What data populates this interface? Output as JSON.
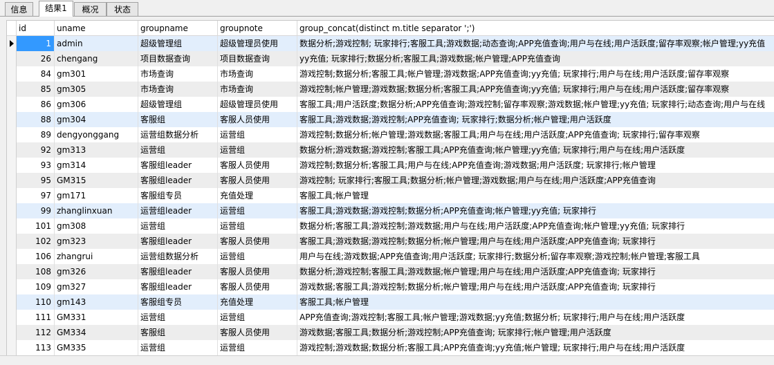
{
  "tabs": [
    {
      "label": "信息"
    },
    {
      "label": "结果1"
    },
    {
      "label": "概况"
    },
    {
      "label": "状态"
    }
  ],
  "columns": [
    "id",
    "uname",
    "groupname",
    "groupnote",
    "group_concat(distinct m.title separator ';')"
  ],
  "rows": [
    {
      "id": "1",
      "uname": "admin",
      "groupname": "超级管理组",
      "groupnote": "超级管理员使用",
      "titles": "数据分析;游戏控制; 玩家排行;客服工具;游戏数据;动态查询;APP充值查询;用户与在线;用户活跃度;留存率观察;帐户管理;yy充值"
    },
    {
      "id": "26",
      "uname": "chengang",
      "groupname": "项目数据查询",
      "groupnote": "项目数据查询",
      "titles": "yy充值; 玩家排行;数据分析;客服工具;游戏数据;帐户管理;APP充值查询"
    },
    {
      "id": "84",
      "uname": "gm301",
      "groupname": "市场查询",
      "groupnote": "市场查询",
      "titles": "游戏控制;数据分析;客服工具;帐户管理;游戏数据;APP充值查询;yy充值; 玩家排行;用户与在线;用户活跃度;留存率观察"
    },
    {
      "id": "85",
      "uname": "gm305",
      "groupname": "市场查询",
      "groupnote": "市场查询",
      "titles": "游戏控制;帐户管理;游戏数据;数据分析;客服工具;APP充值查询;yy充值; 玩家排行;用户与在线;用户活跃度;留存率观察"
    },
    {
      "id": "86",
      "uname": "gm306",
      "groupname": "超级管理组",
      "groupnote": "超级管理员使用",
      "titles": "客服工具;用户活跃度;数据分析;APP充值查询;游戏控制;留存率观察;游戏数据;帐户管理;yy充值; 玩家排行;动态查询;用户与在线"
    },
    {
      "id": "88",
      "uname": "gm304",
      "groupname": "客服组",
      "groupnote": "客服人员使用",
      "titles": "客服工具;游戏数据;游戏控制;APP充值查询; 玩家排行;数据分析;帐户管理;用户活跃度"
    },
    {
      "id": "89",
      "uname": "dengyonggang",
      "groupname": "运营组数据分析",
      "groupnote": "运营组",
      "titles": "游戏控制;数据分析;帐户管理;游戏数据;客服工具;用户与在线;用户活跃度;APP充值查询; 玩家排行;留存率观察"
    },
    {
      "id": "92",
      "uname": "gm313",
      "groupname": "运营组",
      "groupnote": "运营组",
      "titles": "数据分析;游戏数据;游戏控制;客服工具;APP充值查询;帐户管理;yy充值; 玩家排行;用户与在线;用户活跃度"
    },
    {
      "id": "93",
      "uname": "gm314",
      "groupname": "客服组leader",
      "groupnote": "客服人员使用",
      "titles": "游戏控制;数据分析;客服工具;用户与在线;APP充值查询;游戏数据;用户活跃度; 玩家排行;帐户管理"
    },
    {
      "id": "95",
      "uname": "GM315",
      "groupname": "客服组leader",
      "groupnote": "客服人员使用",
      "titles": "游戏控制; 玩家排行;客服工具;数据分析;帐户管理;游戏数据;用户与在线;用户活跃度;APP充值查询"
    },
    {
      "id": "97",
      "uname": "gm171",
      "groupname": "客服组专员",
      "groupnote": "充值处理",
      "titles": "客服工具;帐户管理"
    },
    {
      "id": "99",
      "uname": "zhanglinxuan",
      "groupname": "运营组leader",
      "groupnote": "运营组",
      "titles": "客服工具;游戏数据;游戏控制;数据分析;APP充值查询;帐户管理;yy充值; 玩家排行"
    },
    {
      "id": "101",
      "uname": "gm308",
      "groupname": "运营组",
      "groupnote": "运营组",
      "titles": "数据分析;客服工具;游戏控制;游戏数据;用户与在线;用户活跃度;APP充值查询;帐户管理;yy充值; 玩家排行"
    },
    {
      "id": "102",
      "uname": "gm323",
      "groupname": "客服组leader",
      "groupnote": "客服人员使用",
      "titles": "客服工具;游戏数据;游戏控制;数据分析;帐户管理;用户与在线;用户活跃度;APP充值查询; 玩家排行"
    },
    {
      "id": "106",
      "uname": "zhangrui",
      "groupname": "运营组数据分析",
      "groupnote": "运营组",
      "titles": "用户与在线;游戏数据;APP充值查询;用户活跃度; 玩家排行;数据分析;留存率观察;游戏控制;帐户管理;客服工具"
    },
    {
      "id": "108",
      "uname": "gm326",
      "groupname": "客服组leader",
      "groupnote": "客服人员使用",
      "titles": "数据分析;游戏控制;客服工具;游戏数据;帐户管理;用户与在线;用户活跃度;APP充值查询; 玩家排行"
    },
    {
      "id": "109",
      "uname": "gm327",
      "groupname": "客服组leader",
      "groupnote": "客服人员使用",
      "titles": "游戏数据;客服工具;游戏控制;数据分析;帐户管理;用户与在线;用户活跃度;APP充值查询; 玩家排行"
    },
    {
      "id": "110",
      "uname": "gm143",
      "groupname": "客服组专员",
      "groupnote": "充值处理",
      "titles": "客服工具;帐户管理"
    },
    {
      "id": "111",
      "uname": "GM331",
      "groupname": "运营组",
      "groupnote": "运营组",
      "titles": "APP充值查询;游戏控制;客服工具;帐户管理;游戏数据;yy充值;数据分析; 玩家排行;用户与在线;用户活跃度"
    },
    {
      "id": "112",
      "uname": "GM334",
      "groupname": "客服组",
      "groupnote": "客服人员使用",
      "titles": "游戏数据;客服工具;数据分析;游戏控制;APP充值查询; 玩家排行;帐户管理;用户活跃度"
    },
    {
      "id": "113",
      "uname": "GM335",
      "groupname": "运营组",
      "groupnote": "运营组",
      "titles": "游戏控制;游戏数据;数据分析;客服工具;APP充值查询;yy充值;帐户管理; 玩家排行;用户与在线;用户活跃度"
    }
  ]
}
